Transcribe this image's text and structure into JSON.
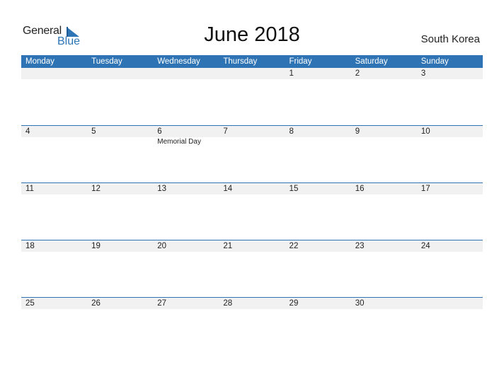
{
  "logo": {
    "line1": "General",
    "line2": "Blue",
    "icon": "triangle-flag-icon"
  },
  "title": "June 2018",
  "country": "South Korea",
  "colors": {
    "accent": "#2e74b5",
    "strip": "#f1f1f1"
  },
  "weekdays": [
    "Monday",
    "Tuesday",
    "Wednesday",
    "Thursday",
    "Friday",
    "Saturday",
    "Sunday"
  ],
  "weeks": [
    [
      {
        "day": ""
      },
      {
        "day": ""
      },
      {
        "day": ""
      },
      {
        "day": ""
      },
      {
        "day": "1"
      },
      {
        "day": "2"
      },
      {
        "day": "3"
      }
    ],
    [
      {
        "day": "4"
      },
      {
        "day": "5"
      },
      {
        "day": "6",
        "event": "Memorial Day"
      },
      {
        "day": "7"
      },
      {
        "day": "8"
      },
      {
        "day": "9"
      },
      {
        "day": "10"
      }
    ],
    [
      {
        "day": "11"
      },
      {
        "day": "12"
      },
      {
        "day": "13"
      },
      {
        "day": "14"
      },
      {
        "day": "15"
      },
      {
        "day": "16"
      },
      {
        "day": "17"
      }
    ],
    [
      {
        "day": "18"
      },
      {
        "day": "19"
      },
      {
        "day": "20"
      },
      {
        "day": "21"
      },
      {
        "day": "22"
      },
      {
        "day": "23"
      },
      {
        "day": "24"
      }
    ],
    [
      {
        "day": "25"
      },
      {
        "day": "26"
      },
      {
        "day": "27"
      },
      {
        "day": "28"
      },
      {
        "day": "29"
      },
      {
        "day": "30"
      },
      {
        "day": ""
      }
    ]
  ]
}
